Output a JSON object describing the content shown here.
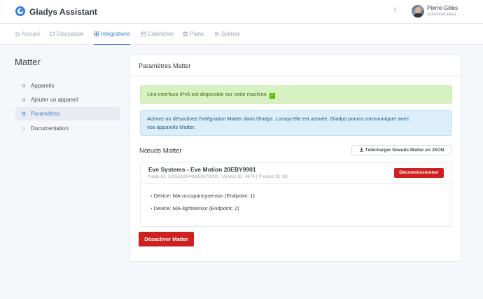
{
  "header": {
    "brand": "Gladys Assistant",
    "theme_icon": "moon-icon",
    "user_name": "Pierre-Gilles",
    "user_role": "Administrateur"
  },
  "nav": {
    "items": [
      {
        "label": "Accueil",
        "icon": "home-icon",
        "active": false
      },
      {
        "label": "Discussion",
        "icon": "message-icon",
        "active": false
      },
      {
        "label": "Intégrations",
        "icon": "grid-icon",
        "active": true
      },
      {
        "label": "Calendrier",
        "icon": "calendar-icon",
        "active": false
      },
      {
        "label": "Plans",
        "icon": "map-icon",
        "active": false
      },
      {
        "label": "Scènes",
        "icon": "play-icon",
        "active": false
      }
    ]
  },
  "sidebar": {
    "title": "Matter",
    "items": [
      {
        "label": "Appareils",
        "icon": "settings-icon",
        "active": false
      },
      {
        "label": "Ajouter un appareil",
        "icon": "plus-circle-icon",
        "active": false
      },
      {
        "label": "Paramètres",
        "icon": "settings-icon",
        "active": true
      },
      {
        "label": "Documentation",
        "icon": "book-icon",
        "active": false
      }
    ]
  },
  "card": {
    "title": "Paramètres Matter",
    "ipv6_alert": "Une interface IPv6 est disponible sur cette machine",
    "info_alert_line1": "Activez ou désactivez l'intégration Matter dans Gladys. Lorsqu'elle est activée, Gladys pourra communiquer avec",
    "info_alert_line2": "vos appareils Matter.",
    "nodes_title": "Nœuds Matter",
    "download_button": "Télécharger Noeuds Matter en JSON",
    "node": {
      "name": "Eve Systems - Eve Motion 20EBY9901",
      "ids": "Node ID: 12058191448958679000 | Vendor ID: 4874 | Product ID: 89",
      "decommission_button": "Décommissionner",
      "devices": [
        "Device: MA-occupancysensor (Endpoint: 1)",
        "Device: MA-lightsensor (Endpoint: 2)"
      ]
    },
    "deactivate_button": "Désactiver Matter"
  },
  "colors": {
    "accent": "#467fcf",
    "danger": "#cd201f",
    "success_bg": "#d7f2c2",
    "info_bg": "#dbeefa"
  }
}
